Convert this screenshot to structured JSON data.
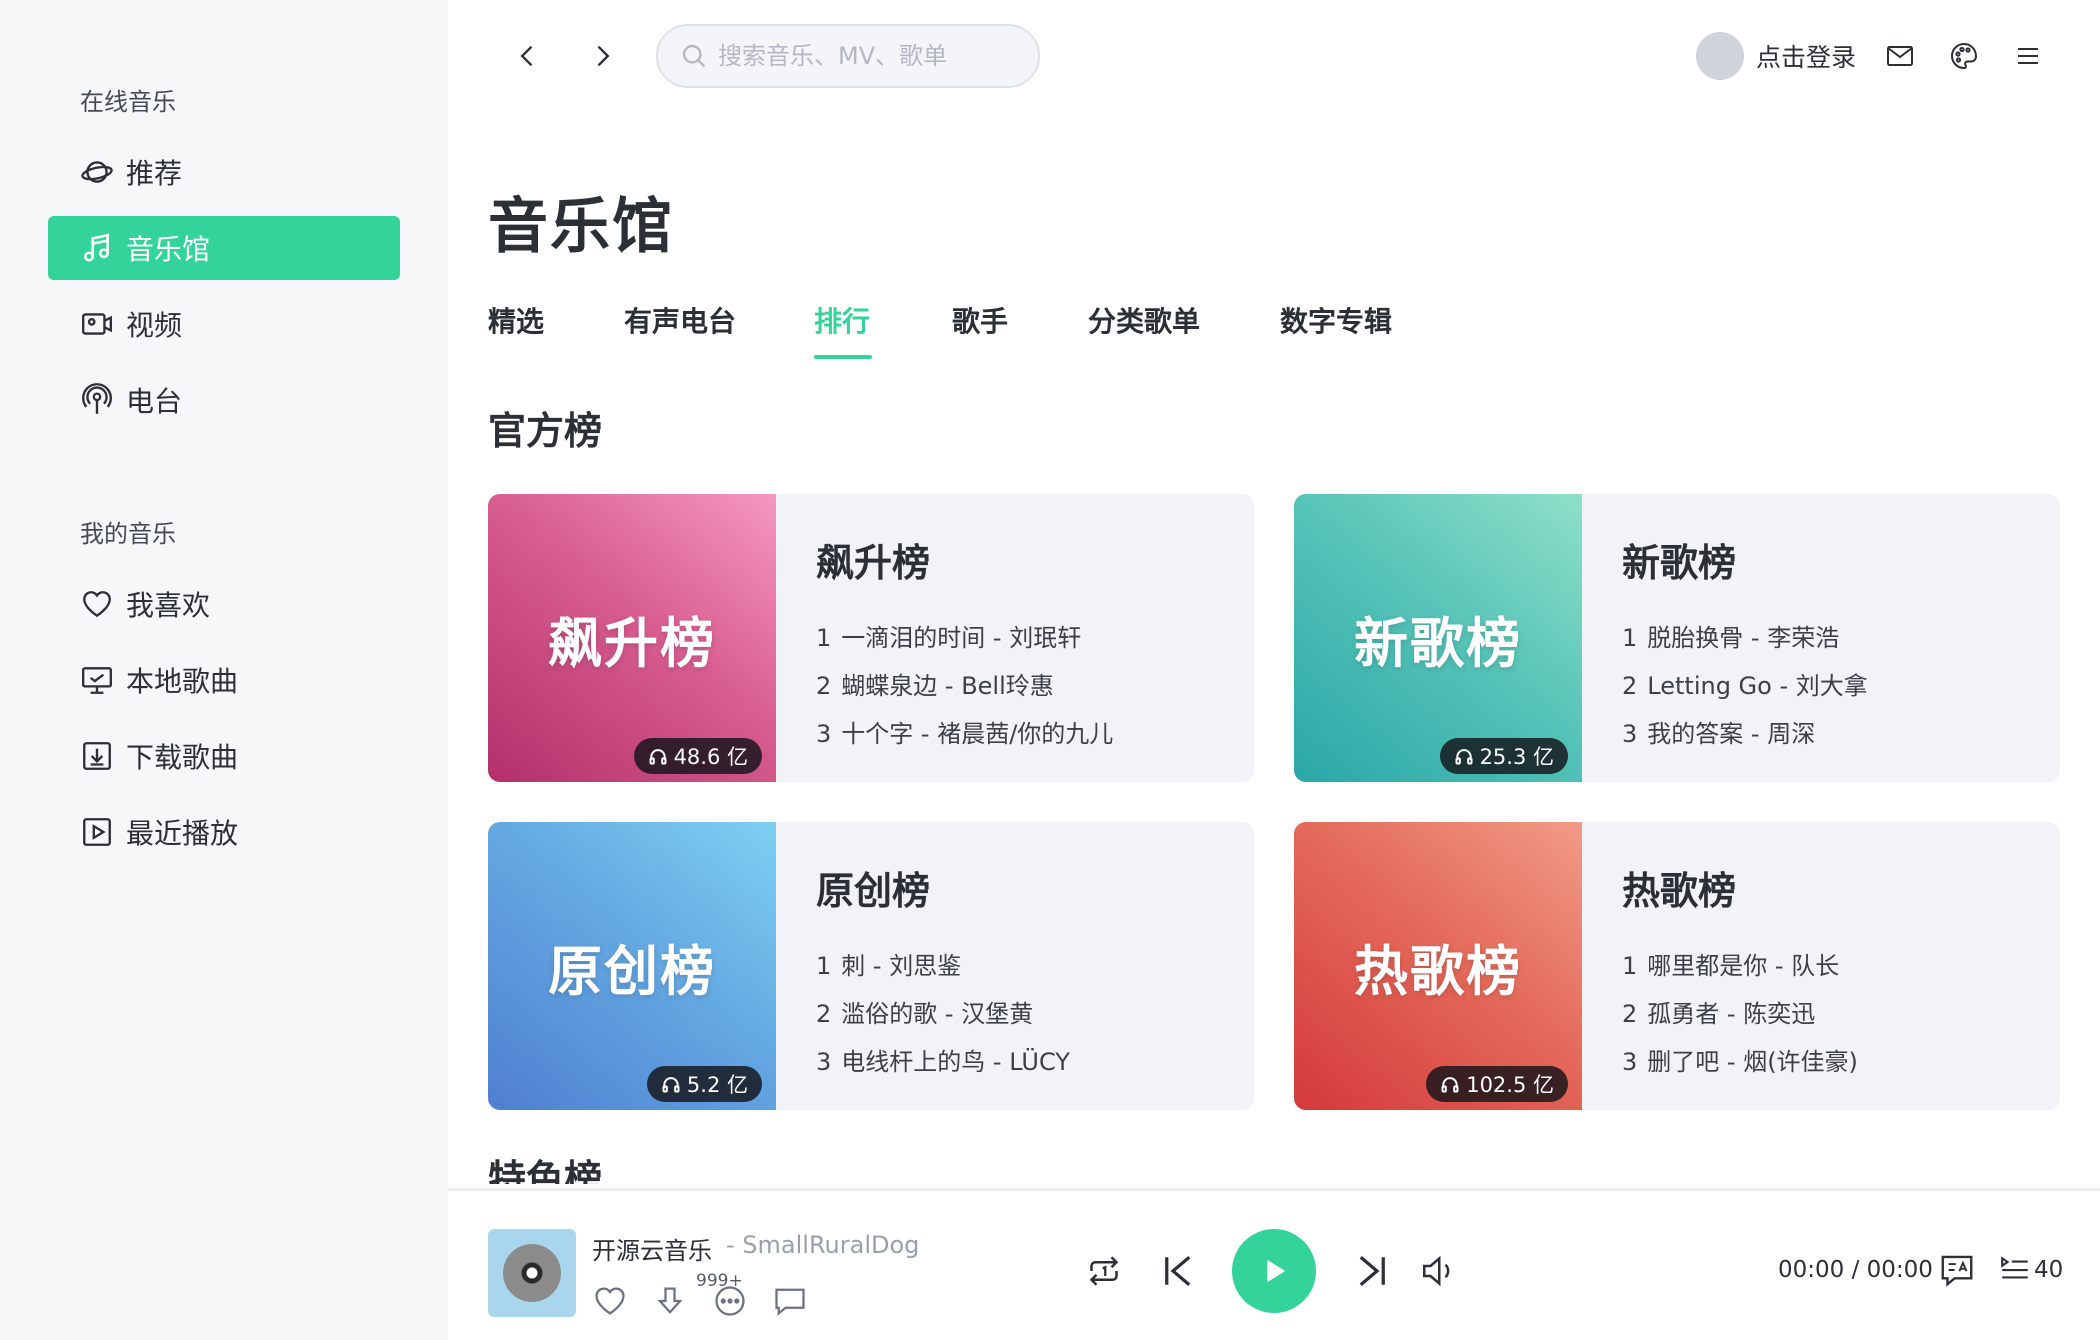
{
  "sidebar": {
    "online_title": "在线音乐",
    "online_items": [
      {
        "label": "推荐",
        "icon": "planet-icon"
      },
      {
        "label": "音乐馆",
        "icon": "music-note-icon",
        "active": true
      },
      {
        "label": "视频",
        "icon": "video-icon"
      },
      {
        "label": "电台",
        "icon": "radio-icon"
      }
    ],
    "mine_title": "我的音乐",
    "mine_items": [
      {
        "label": "我喜欢",
        "icon": "heart-icon"
      },
      {
        "label": "本地歌曲",
        "icon": "monitor-icon"
      },
      {
        "label": "下载歌曲",
        "icon": "download-icon"
      },
      {
        "label": "最近播放",
        "icon": "play-square-icon"
      }
    ]
  },
  "topbar": {
    "search_placeholder": "搜索音乐、MV、歌单",
    "search_value": "",
    "login": "点击登录"
  },
  "main": {
    "title": "音乐馆",
    "tabs": [
      "精选",
      "有声电台",
      "排行",
      "歌手",
      "分类歌单",
      "数字专辑"
    ],
    "active_tab": "排行",
    "section_official": "官方榜",
    "section_next": "特色榜",
    "charts": [
      {
        "cover_title": "飙升榜",
        "name": "飙升榜",
        "plays": "48.6 亿",
        "songs": [
          {
            "rank": "1",
            "text": "一滴泪的时间 - 刘珉轩"
          },
          {
            "rank": "2",
            "text": "蝴蝶泉边 - Bell玲惠"
          },
          {
            "rank": "3",
            "text": "十个字 - 褚晨茜/你的九儿"
          }
        ]
      },
      {
        "cover_title": "新歌榜",
        "name": "新歌榜",
        "plays": "25.3 亿",
        "songs": [
          {
            "rank": "1",
            "text": "脱胎换骨 - 李荣浩"
          },
          {
            "rank": "2",
            "text": "Letting Go - 刘大拿"
          },
          {
            "rank": "3",
            "text": "我的答案 - 周深"
          }
        ]
      },
      {
        "cover_title": "原创榜",
        "name": "原创榜",
        "plays": "5.2 亿",
        "songs": [
          {
            "rank": "1",
            "text": "刺 - 刘思鉴"
          },
          {
            "rank": "2",
            "text": "滥俗的歌 - 汉堡黄"
          },
          {
            "rank": "3",
            "text": "电线杆上的鸟 - LÜCY"
          }
        ]
      },
      {
        "cover_title": "热歌榜",
        "name": "热歌榜",
        "plays": "102.5 亿",
        "songs": [
          {
            "rank": "1",
            "text": "哪里都是你 - 队长"
          },
          {
            "rank": "2",
            "text": "孤勇者 - 陈奕迅"
          },
          {
            "rank": "3",
            "text": "删了吧 - 烟(许佳豪)"
          }
        ]
      }
    ]
  },
  "player": {
    "title": "开源云音乐",
    "artist": "- SmallRuralDog",
    "comment_badge": "999+",
    "time": "00:00 / 00:00",
    "queue_count": "40"
  },
  "colors": {
    "accent": "#33d39a",
    "sidebar_bg": "#f6f7f9",
    "card_bg": "#f2f3f6",
    "text": "#2b2f36"
  }
}
